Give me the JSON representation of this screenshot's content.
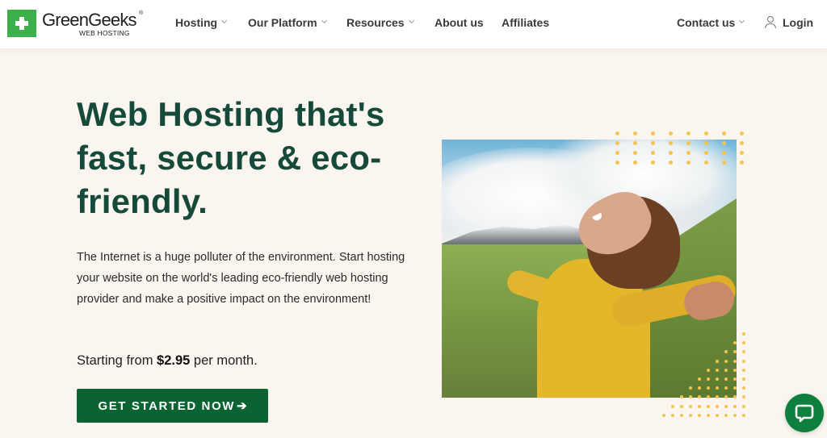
{
  "brand": {
    "name": "GreenGeeks",
    "registered": "®",
    "tagline": "WEB HOSTING",
    "logo_color": "#3cb04b"
  },
  "nav": {
    "items": [
      {
        "label": "Hosting",
        "has_dropdown": true
      },
      {
        "label": "Our Platform",
        "has_dropdown": true
      },
      {
        "label": "Resources",
        "has_dropdown": true
      },
      {
        "label": "About us",
        "has_dropdown": false
      },
      {
        "label": "Affiliates",
        "has_dropdown": false
      }
    ],
    "contact": {
      "label": "Contact us",
      "has_dropdown": true
    },
    "login": {
      "label": "Login",
      "icon": "user-icon"
    }
  },
  "hero": {
    "title": "Web Hosting that's fast, secure & eco-friendly.",
    "description": "The Internet is a huge polluter of the environment. Start hosting your website on the world's leading eco-friendly web hosting provider and make a positive impact on the environment!",
    "price_prefix": "Starting from ",
    "price": "$2.95",
    "price_suffix": " per month.",
    "cta_label": "GET STARTED NOW",
    "cta_icon": "arrow-right-icon",
    "image_alt": "Woman in yellow jacket with arms outstretched in green mountain landscape"
  },
  "chat": {
    "icon": "chat-bubble-icon"
  },
  "colors": {
    "heading": "#154a3a",
    "cta_bg": "#0a6330",
    "page_bg": "#faf6ef",
    "dot_accent": "#f3c44e",
    "chat_bg": "#0f7f3d"
  }
}
